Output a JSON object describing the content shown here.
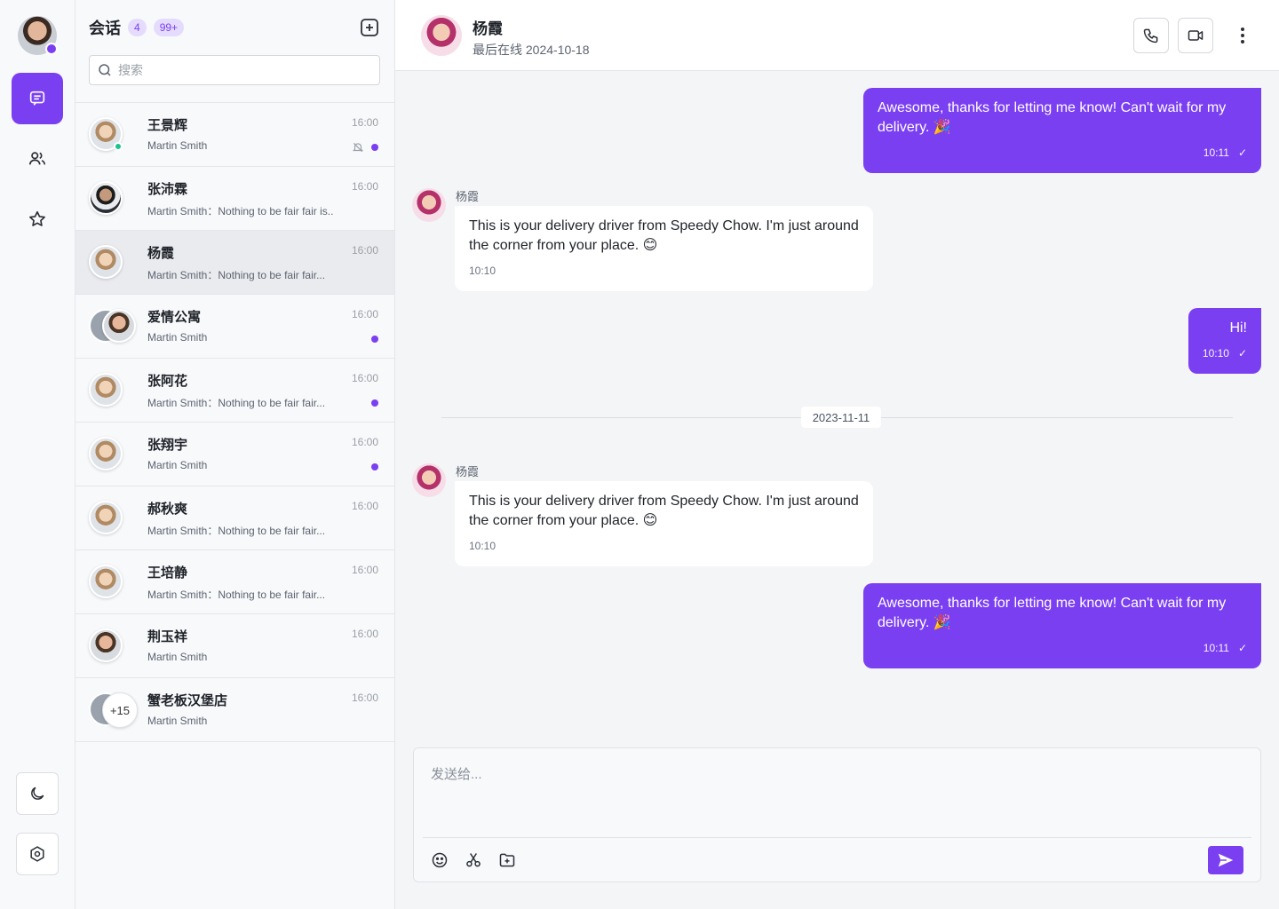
{
  "colors": {
    "accent": "#7b3ff2",
    "online": "#1ec28b"
  },
  "list": {
    "title": "会话",
    "count_badge": "4",
    "unread_badge": "99+",
    "search_placeholder": "搜索",
    "conversations": [
      {
        "name": "王景辉",
        "time": "16:00",
        "preview": "Martin Smith",
        "muted": true,
        "unread": true,
        "online": true
      },
      {
        "name": "张沛霖",
        "time": "16:00",
        "preview": "Martin Smith：Nothing to be fair fair is..",
        "unread": false
      },
      {
        "name": "杨霞",
        "time": "16:00",
        "preview": "Martin Smith：Nothing to be fair fair...",
        "selected": true,
        "unread": false
      },
      {
        "name": "爱情公寓",
        "time": "16:00",
        "preview": "Martin Smith",
        "unread": true,
        "group": true
      },
      {
        "name": "张阿花",
        "time": "16:00",
        "preview": "Martin Smith：Nothing to be fair fair...",
        "unread": true
      },
      {
        "name": "张翔宇",
        "time": "16:00",
        "preview": "Martin Smith",
        "unread": true
      },
      {
        "name": "郝秋爽",
        "time": "16:00",
        "preview": "Martin Smith：Nothing to be fair fair...",
        "unread": false
      },
      {
        "name": "王培静",
        "time": "16:00",
        "preview": "Martin Smith：Nothing to be fair fair...",
        "unread": false
      },
      {
        "name": "荆玉祥",
        "time": "16:00",
        "preview": "Martin Smith",
        "unread": false
      },
      {
        "name": "蟹老板汉堡店",
        "time": "16:00",
        "preview": "Martin Smith",
        "unread": false,
        "group_extra": "+15"
      }
    ]
  },
  "chat": {
    "contact_name": "杨霞",
    "status": "最后在线 2024-10-18",
    "messages": [
      {
        "direction": "out",
        "text": "Awesome, thanks for letting me know! Can't wait for my delivery. 🎉",
        "time": "10:11"
      },
      {
        "direction": "in",
        "sender": "杨霞",
        "text": "This is your delivery driver from Speedy Chow. I'm just around the corner from your place. 😊",
        "time": "10:10"
      },
      {
        "direction": "out",
        "text": "Hi!",
        "time": "10:10"
      },
      {
        "direction": "in",
        "sender": "杨霞",
        "text": "This is your delivery driver from Speedy Chow. I'm just around the corner from your place. 😊",
        "time": "10:10"
      },
      {
        "direction": "out",
        "text": "Awesome, thanks for letting me know! Can't wait for my delivery. 🎉",
        "time": "10:11"
      }
    ],
    "date_divider": "2023-11-11",
    "composer_placeholder": "发送给...",
    "read_check": "✓"
  },
  "icons": {
    "rail": [
      "chat-icon",
      "contacts-icon",
      "star-icon"
    ],
    "rail_bottom": [
      "moon-icon",
      "settings-icon"
    ],
    "header": [
      "phone-icon",
      "video-icon",
      "more-vertical-icon"
    ],
    "composer": [
      "emoji-icon",
      "scissors-icon",
      "folder-icon",
      "send-icon"
    ]
  }
}
